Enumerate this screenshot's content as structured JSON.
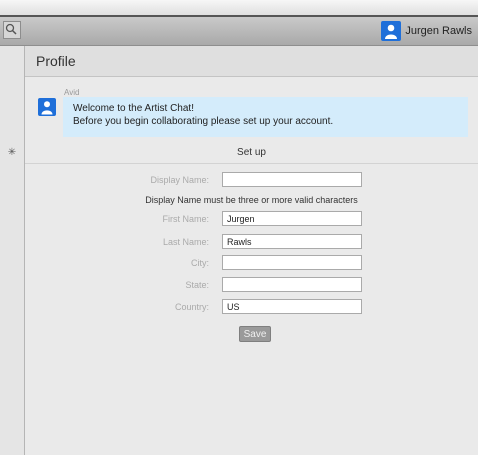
{
  "header": {
    "user_name": "Jurgen Rawls"
  },
  "profile": {
    "title": "Profile"
  },
  "message": {
    "sender": "Avid",
    "line1": "Welcome to the Artist Chat!",
    "line2": "Before you begin collaborating please set up your account."
  },
  "setup": {
    "title": "Set up",
    "error_text": "Display Name must be three or more valid characters",
    "fields": [
      {
        "label": "Display Name:",
        "value": ""
      },
      {
        "label": "First Name:",
        "value": "Jurgen"
      },
      {
        "label": "Last Name:",
        "value": "Rawls"
      },
      {
        "label": "City:",
        "value": ""
      },
      {
        "label": "State:",
        "value": ""
      },
      {
        "label": "Country:",
        "value": "US"
      }
    ],
    "save_label": "Save"
  },
  "colors": {
    "accent_blue": "#1f6fd9",
    "bubble_bg": "#d4ecfb",
    "panel_bg": "#eaeaea"
  }
}
